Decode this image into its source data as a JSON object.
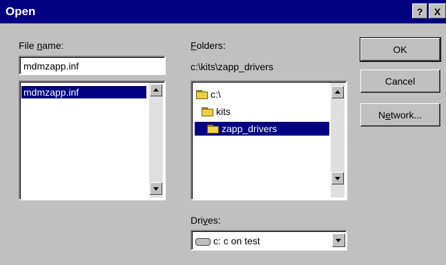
{
  "window": {
    "title": "Open",
    "help_glyph": "?",
    "close_glyph": "X"
  },
  "filename": {
    "label_prefix": "File ",
    "label_access": "n",
    "label_suffix": "ame:",
    "value": "mdmzapp.inf",
    "list_items": [
      "mdmzapp.inf"
    ]
  },
  "folders": {
    "label_access": "F",
    "label_suffix": "olders:",
    "current_path": "c:\\kits\\zapp_drivers",
    "tree": [
      {
        "label": "c:\\",
        "state": "open"
      },
      {
        "label": "kits",
        "state": "open"
      },
      {
        "label": "zapp_drivers",
        "state": "open",
        "selected": true
      }
    ]
  },
  "drives": {
    "label_prefix": "Dri",
    "label_access": "v",
    "label_suffix": "es:",
    "value": "c: c on test"
  },
  "buttons": {
    "ok": "OK",
    "cancel": "Cancel",
    "network_prefix": "N",
    "network_access": "e",
    "network_suffix": "twork..."
  },
  "colors": {
    "title_bar": "#000080",
    "face": "#c0c0c0",
    "selection": "#000080"
  }
}
